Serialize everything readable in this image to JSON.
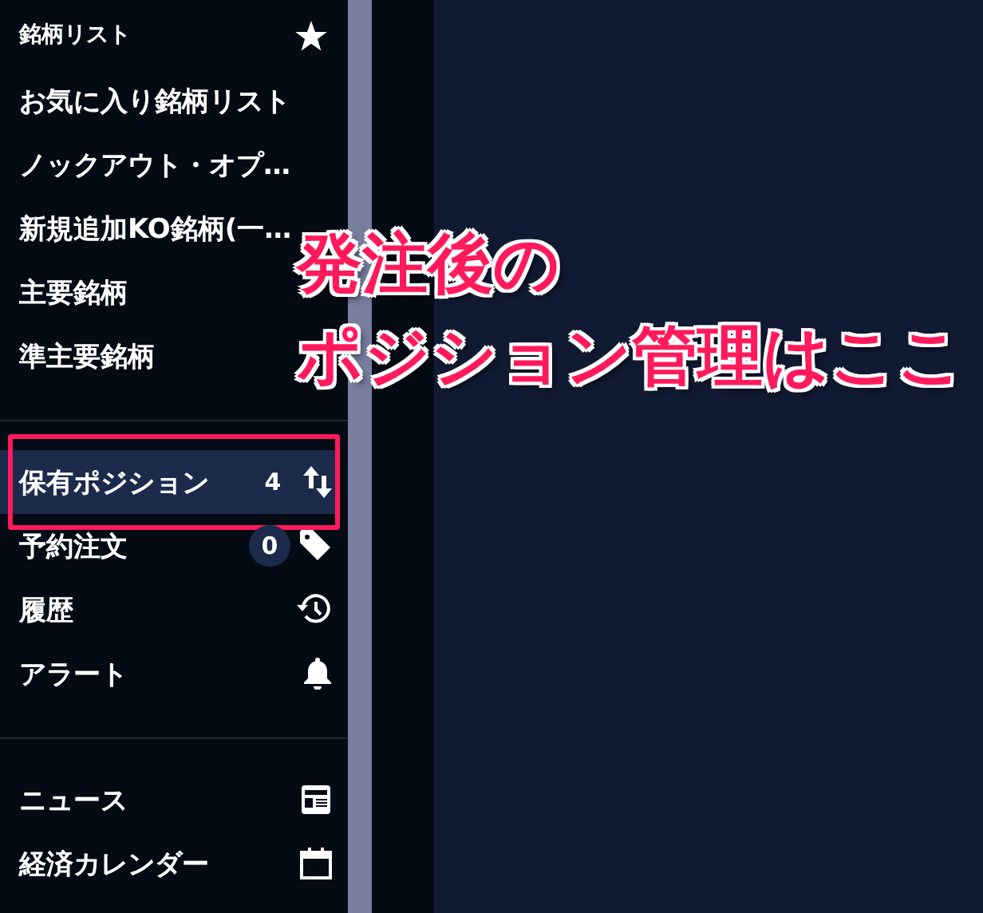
{
  "sidebar": {
    "sections": [
      {
        "header": "銘柄リスト",
        "items": [
          {
            "label": "お気に入り銘柄リスト",
            "selected": false,
            "framed": false
          },
          {
            "label": "ノックアウト・オプ…",
            "selected": false,
            "framed": false
          },
          {
            "label": "新規追加KO銘柄(一…",
            "selected": false,
            "framed": false
          },
          {
            "label": "主要銘柄",
            "selected": false,
            "framed": false
          },
          {
            "label": "準主要銘柄",
            "selected": false,
            "framed": false
          }
        ]
      },
      {
        "items": [
          {
            "label": "保有ポジション",
            "count": "4",
            "selected": true,
            "framed": true
          },
          {
            "label": "予約注文",
            "count": "0",
            "selected": false,
            "framed": false
          },
          {
            "label": "履歴",
            "selected": false,
            "framed": false
          },
          {
            "label": "アラート",
            "selected": false,
            "framed": false
          }
        ]
      },
      {
        "items": [
          {
            "label": "ニュース",
            "selected": false,
            "framed": false
          },
          {
            "label": "経済カレンダー",
            "selected": false,
            "framed": false
          }
        ]
      }
    ]
  },
  "annotation": {
    "lines": [
      "発注後の",
      "ポジション管理はここ"
    ]
  }
}
